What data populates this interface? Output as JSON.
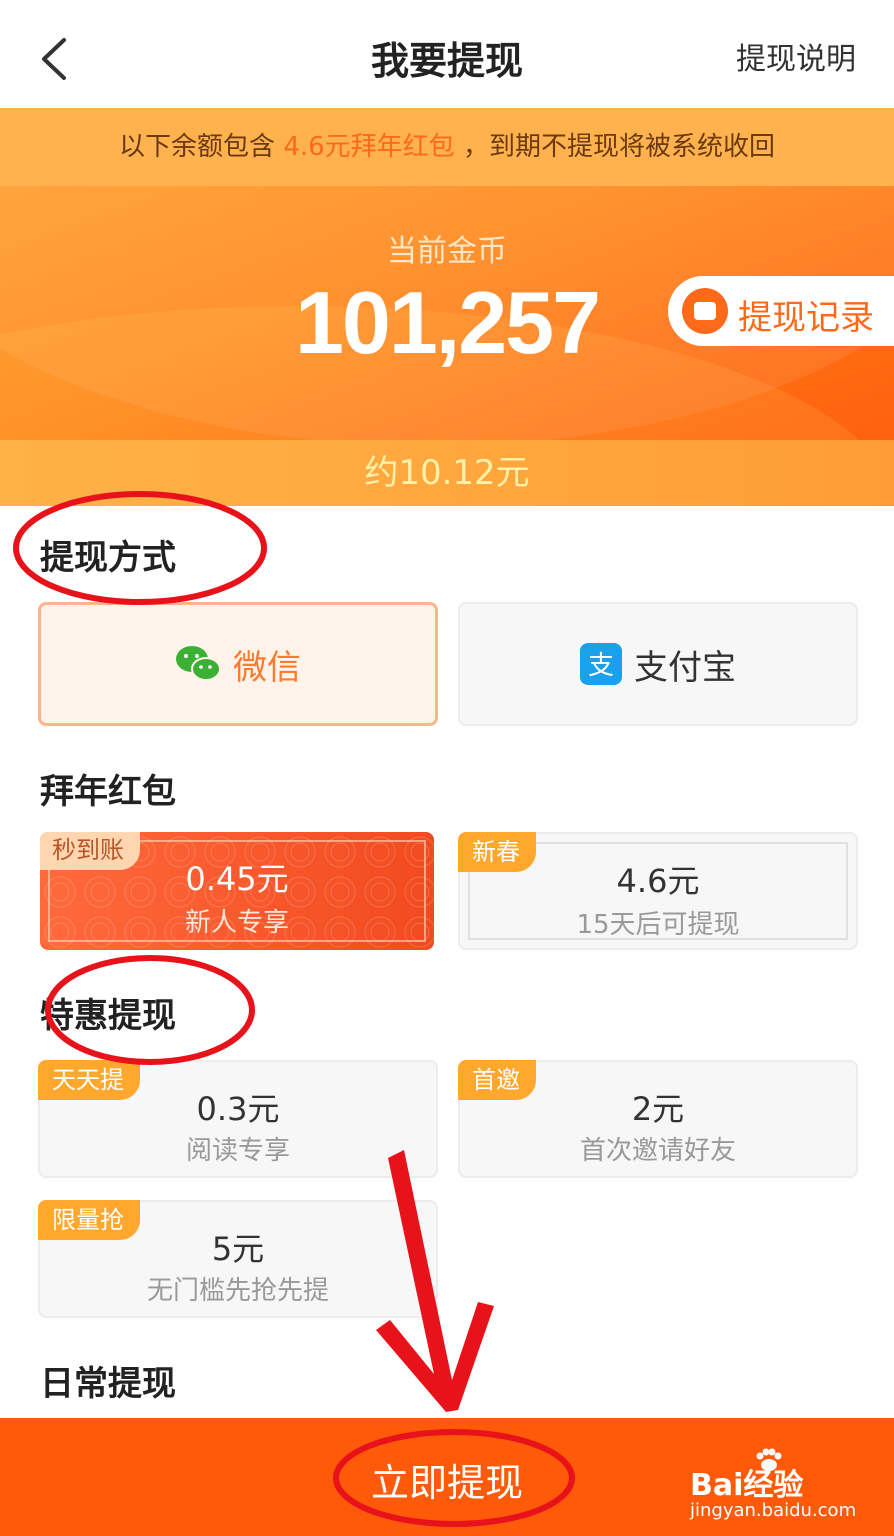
{
  "header": {
    "title": "我要提现",
    "help_label": "提现说明"
  },
  "notice": {
    "prefix": "以下余额包含",
    "highlight": "4.6元拜年红包",
    "suffix": "，到期不提现将被系统收回"
  },
  "balance": {
    "label": "当前金币",
    "coins": "101,257",
    "approx": "约10.12元",
    "record_label": "提现记录"
  },
  "payment": {
    "title": "提现方式",
    "methods": [
      {
        "label": "微信",
        "selected": true
      },
      {
        "label": "支付宝",
        "selected": false
      }
    ]
  },
  "new_year": {
    "title": "拜年红包",
    "cards": [
      {
        "tag": "秒到账",
        "amount": "0.45元",
        "note": "新人专享"
      },
      {
        "tag": "新春",
        "amount": "4.6元",
        "note": "15天后可提现"
      }
    ]
  },
  "special": {
    "title": "特惠提现",
    "cards": [
      {
        "tag": "天天提",
        "amount": "0.3元",
        "note": "阅读专享"
      },
      {
        "tag": "首邀",
        "amount": "2元",
        "note": "首次邀请好友"
      },
      {
        "tag": "限量抢",
        "amount": "5元",
        "note": "无门槛先抢先提"
      }
    ]
  },
  "daily": {
    "title": "日常提现"
  },
  "footer": {
    "button_label": "立即提现"
  },
  "watermark": {
    "brand": "Bai经验",
    "url": "jingyan.baidu.com"
  },
  "colors": {
    "accent": "#ff6a1a",
    "tag": "#ffa82d",
    "notice_bg": "#ffb24d",
    "footer_bg": "#ff5a0a",
    "annotation": "#e8121a"
  }
}
